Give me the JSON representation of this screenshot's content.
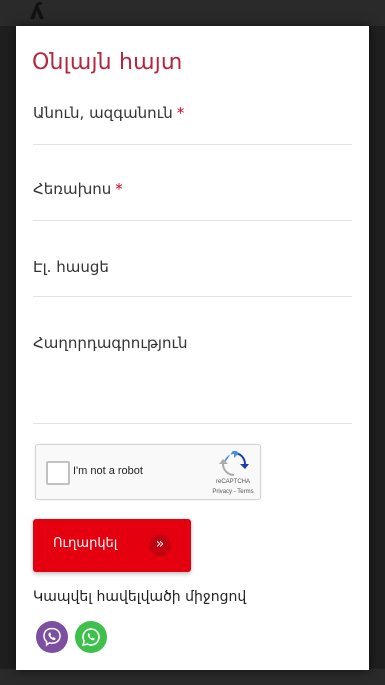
{
  "form": {
    "title": "Օնլայն հայտ",
    "fields": {
      "name_label": "Անուն, ազգանուն",
      "phone_label": "Հեռախոս",
      "email_label": "Էլ. հասցե",
      "message_label": "Հաղորդագրություն"
    },
    "required_mark": "*",
    "recaptcha": {
      "label": "I'm not a robot",
      "brand": "reCAPTCHA",
      "terms": "Privacy - Terms"
    },
    "submit_label": "Ուղարկել",
    "submit_arrow": "»",
    "contact_label": "Կապվել հավելվածի միջոցով",
    "messengers": [
      {
        "name": "viber",
        "icon": "viber-icon",
        "color": "#7d4fa0"
      },
      {
        "name": "whatsapp",
        "icon": "whatsapp-icon",
        "color": "#3fbf4b"
      }
    ]
  },
  "colors": {
    "title": "#b3263e",
    "required": "#d0021b",
    "submit_bg": "#e4000f"
  }
}
